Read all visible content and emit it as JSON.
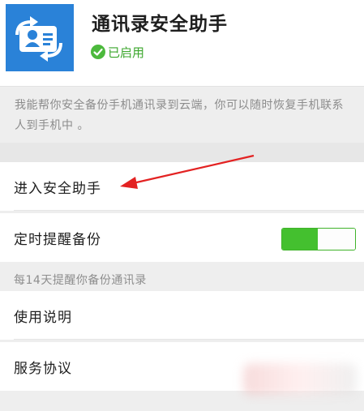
{
  "app": {
    "title": "通讯录安全助手",
    "status": "已启用",
    "icon": "contacts-sync-icon",
    "accent_blue": "#2a82d8",
    "accent_green": "#44c02f"
  },
  "description": "我能帮你安全备份手机通讯录到云端，你可以随时恢复手机联系人到手机中 。",
  "menu": {
    "enter_assistant": "进入安全助手",
    "scheduled_backup": "定时提醒备份",
    "scheduled_backup_enabled": true,
    "backup_hint": "每14天提醒你备份通讯录",
    "usage_guide": "使用说明",
    "service_agreement": "服务协议"
  }
}
